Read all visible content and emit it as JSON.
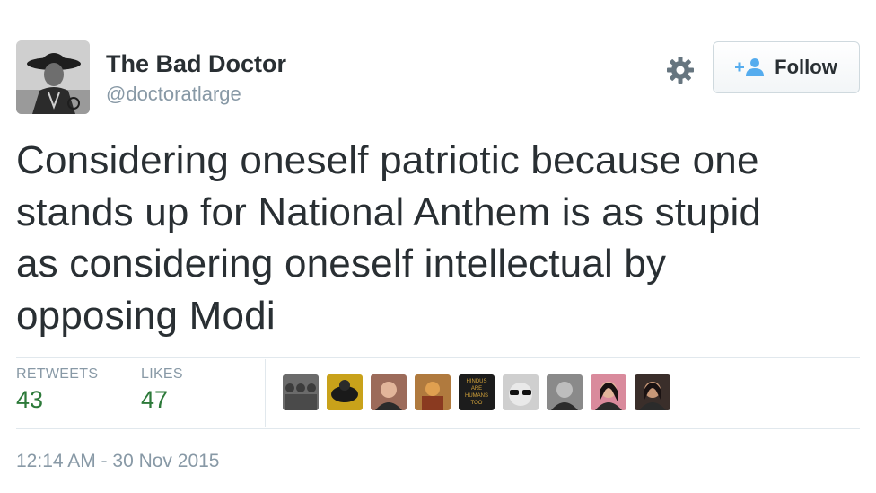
{
  "user": {
    "display_name": "The Bad Doctor",
    "handle": "@doctoratlarge"
  },
  "actions": {
    "follow_label": "Follow"
  },
  "tweet": {
    "lines": [
      "Considering oneself patriotic because one",
      "stands up for National Anthem is as stupid",
      "as considering oneself intellectual by",
      "opposing Modi"
    ],
    "timestamp": "12:14 AM - 30 Nov 2015"
  },
  "stats": {
    "retweets_label": "RETWEETS",
    "retweets_count": "43",
    "likes_label": "LIKES",
    "likes_count": "47"
  },
  "likers": [
    {
      "name": "liker-avatar-1",
      "icon": "group-photo",
      "color": "#6b6b6b"
    },
    {
      "name": "liker-avatar-2",
      "icon": "batman-emblem",
      "color": "#c9a21a"
    },
    {
      "name": "liker-avatar-3",
      "icon": "man-portrait",
      "color": "#9c6b5a"
    },
    {
      "name": "liker-avatar-4",
      "icon": "painting",
      "color": "#b07a3e"
    },
    {
      "name": "liker-avatar-5",
      "icon": "text-image",
      "color": "#1c1c1c",
      "text": [
        "HINDUS",
        "ARE",
        "HUMANS",
        "TOO"
      ]
    },
    {
      "name": "liker-avatar-6",
      "icon": "sunglasses-face",
      "color": "#cfcfcf"
    },
    {
      "name": "liker-avatar-7",
      "icon": "man-portrait-bw",
      "color": "#8a8a8a"
    },
    {
      "name": "liker-avatar-8",
      "icon": "woman-portrait",
      "color": "#d98a9c"
    },
    {
      "name": "liker-avatar-9",
      "icon": "woman-portrait-dark",
      "color": "#3a2e2a"
    }
  ],
  "colors": {
    "text": "#292f33",
    "muted": "#8899a6",
    "count_green": "#2d7a3a",
    "follow_icon_blue": "#55acee",
    "border": "#e1e8ed"
  }
}
